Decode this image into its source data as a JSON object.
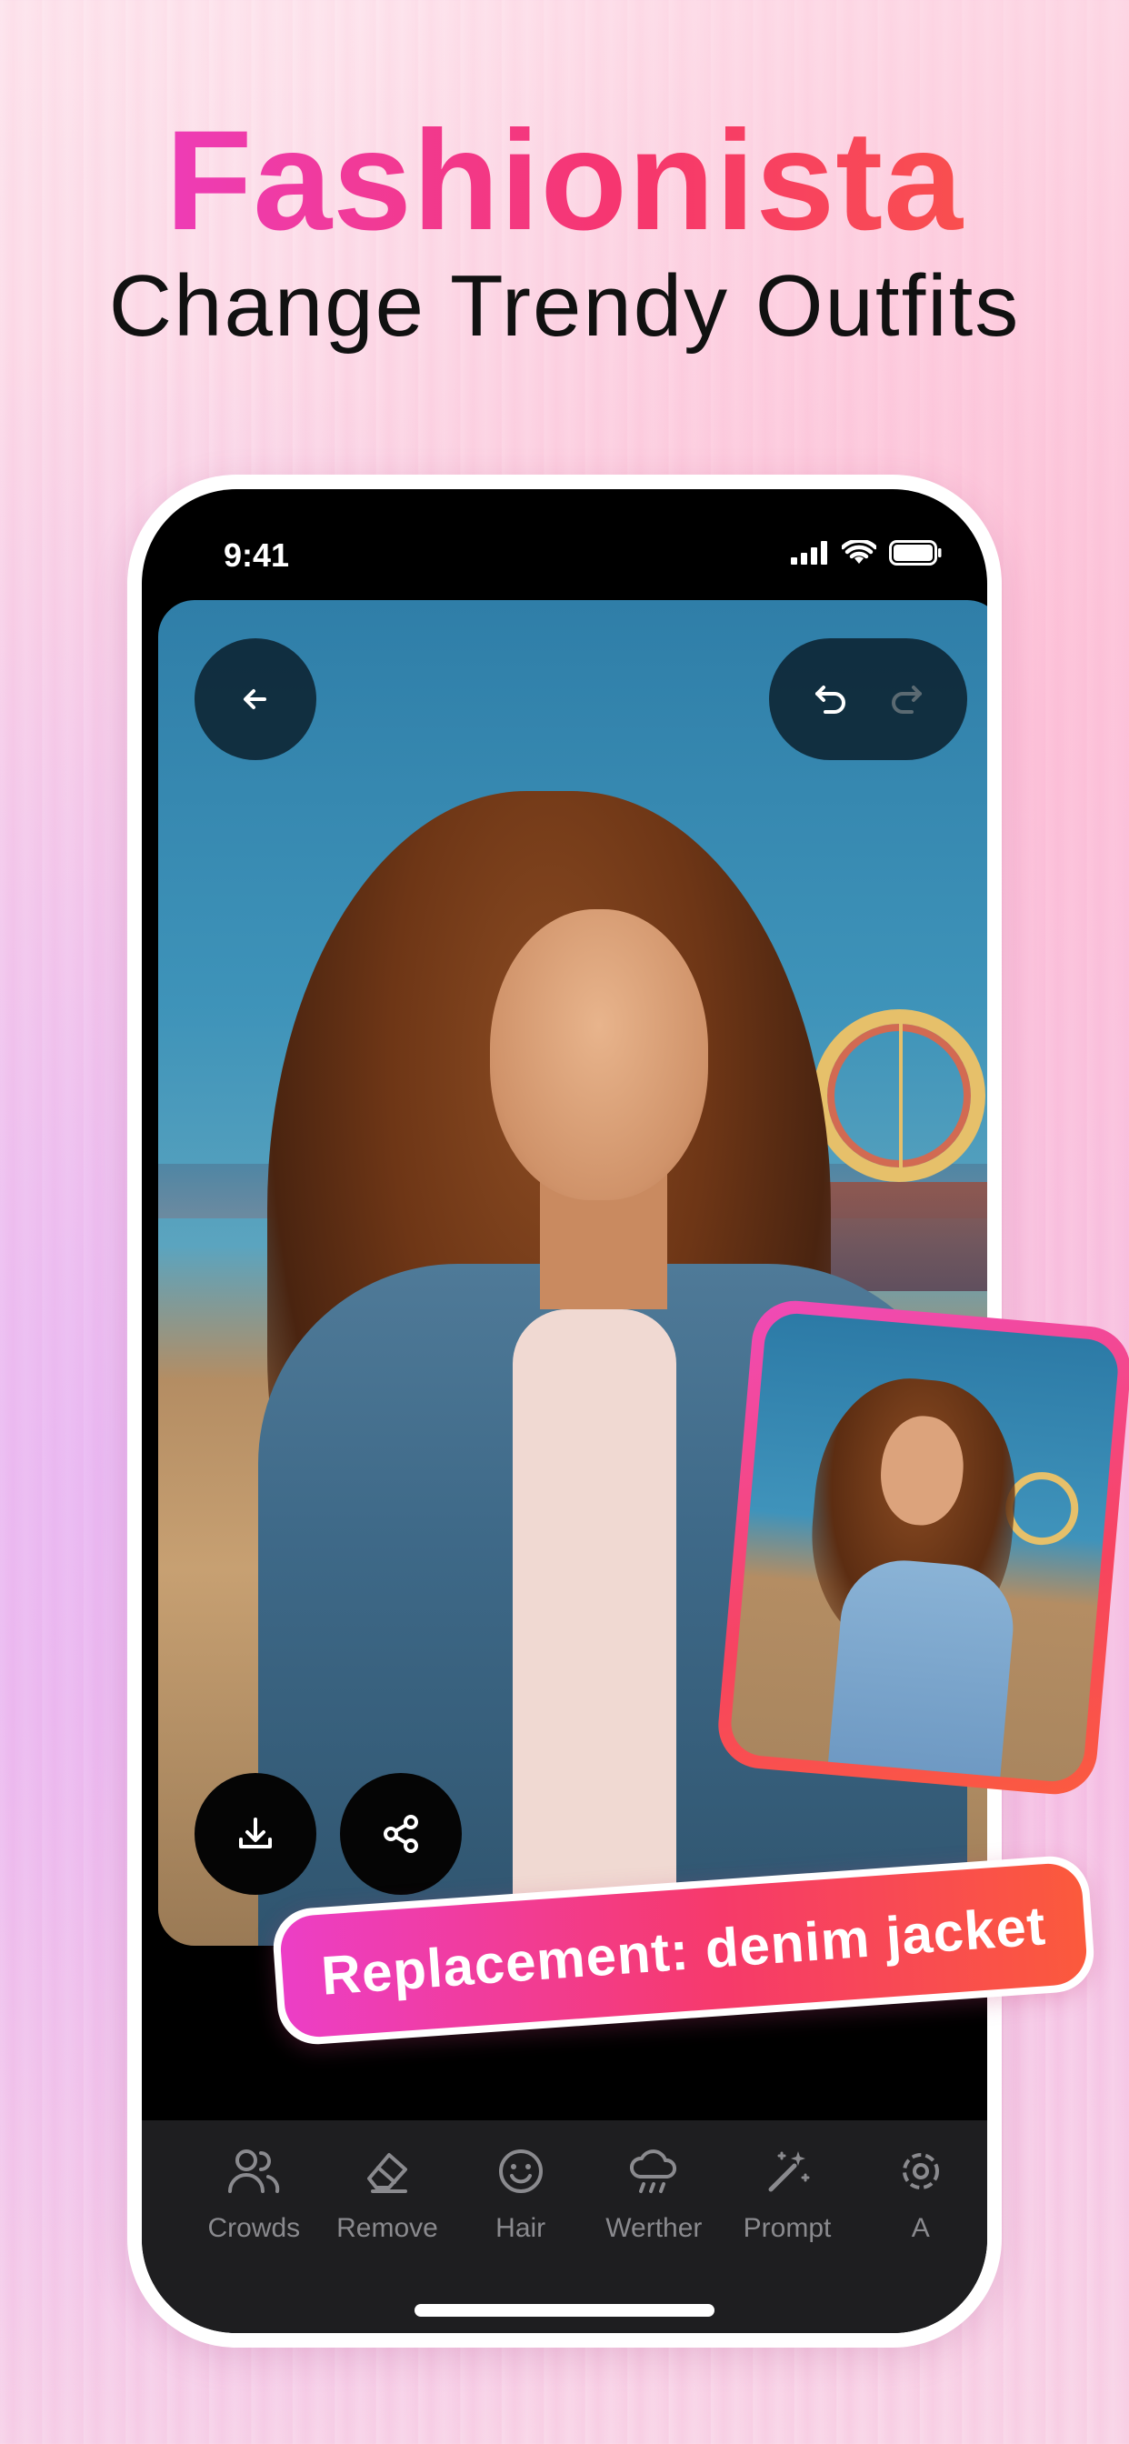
{
  "promo": {
    "title": "Fashionista",
    "subtitle": "Change Trendy Outfits",
    "caption": "Replacement: denim jacket"
  },
  "status_bar": {
    "time": "9:41"
  },
  "editor": {
    "icons": {
      "back": "arrow-left-icon",
      "undo": "undo-icon",
      "redo": "redo-icon",
      "download": "download-icon",
      "share": "share-icon"
    },
    "tools": [
      {
        "label": "Crowds",
        "icon": "people-icon"
      },
      {
        "label": "Remove",
        "icon": "eraser-icon"
      },
      {
        "label": "Hair",
        "icon": "smile-face-icon"
      },
      {
        "label": "Werther",
        "icon": "cloud-rain-icon"
      },
      {
        "label": "Prompt",
        "icon": "magic-wand-icon"
      },
      {
        "label": "A",
        "icon": "gear-icon"
      }
    ]
  },
  "colors": {
    "title_gradient": [
      "#ea3fd0",
      "#f6366f",
      "#fb5b3f"
    ],
    "toolbar_bg": "#1e1e20",
    "tool_label": "#8a8a8e"
  }
}
